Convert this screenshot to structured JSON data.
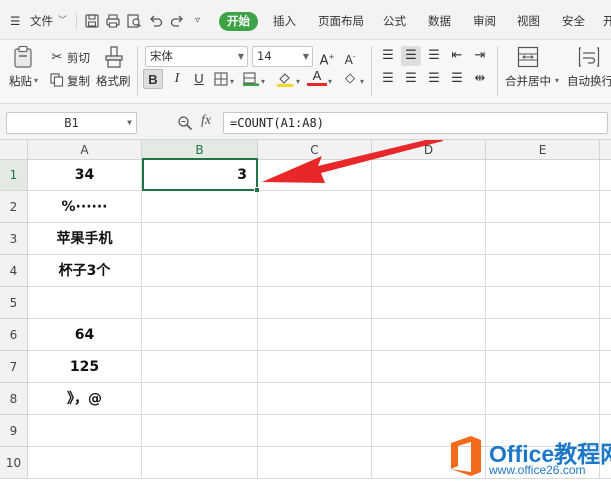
{
  "menu": {
    "file_label": "文件",
    "tabs": [
      {
        "label": "开始",
        "active": true
      },
      {
        "label": "插入"
      },
      {
        "label": "页面布局"
      },
      {
        "label": "公式"
      },
      {
        "label": "数据"
      },
      {
        "label": "审阅"
      },
      {
        "label": "视图"
      },
      {
        "label": "安全"
      },
      {
        "label": "开"
      }
    ]
  },
  "ribbon": {
    "paste_label": "粘贴",
    "cut_label": "剪切",
    "copy_label": "复制",
    "format_painter_label": "格式刷",
    "font_name": "宋体",
    "font_size": "14",
    "bold": "B",
    "italic": "I",
    "underline": "U",
    "merge_label": "合并居中",
    "wrap_label": "自动换行"
  },
  "formula_bar": {
    "name_box": "B1",
    "fx": "fx",
    "formula": "=COUNT(A1:A8)"
  },
  "grid": {
    "columns": [
      "A",
      "B",
      "C",
      "D",
      "E"
    ],
    "rows": [
      "1",
      "2",
      "3",
      "4",
      "5",
      "6",
      "7",
      "8",
      "9",
      "10"
    ],
    "column_a": [
      "34",
      "%······",
      "苹果手机",
      "杯子3个",
      "",
      "64",
      "125",
      "》，@",
      "",
      ""
    ],
    "b1": "3",
    "selected_cell": "B1"
  },
  "colors": {
    "accent_green": "#217346",
    "tab_green": "#3ea346",
    "arrow_red": "#e8272a",
    "watermark_blue": "#1d78c8",
    "logo_orange": "#f26b1d"
  },
  "watermark": {
    "title": "Office教程网",
    "url": "www.office26.com"
  }
}
